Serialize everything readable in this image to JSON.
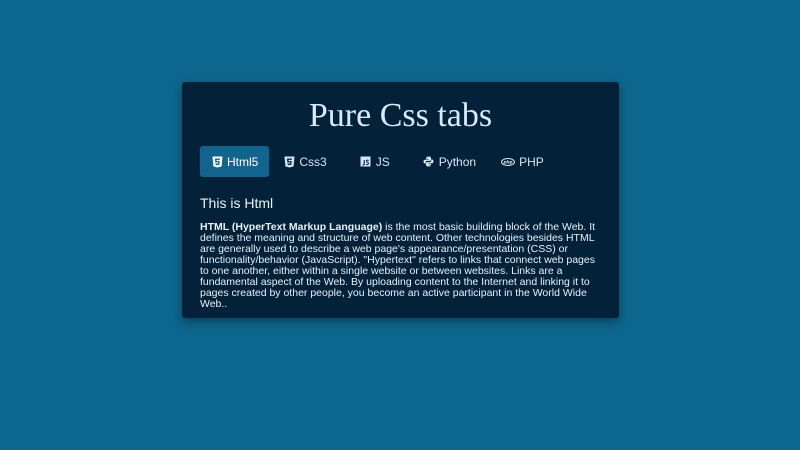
{
  "page": {
    "title": "Pure Css tabs"
  },
  "tabs": [
    {
      "label": "Html5",
      "icon": "html5-icon",
      "active": true
    },
    {
      "label": "Css3",
      "icon": "css3-icon",
      "active": false
    },
    {
      "label": "JS",
      "icon": "js-icon",
      "active": false
    },
    {
      "label": "Python",
      "icon": "python-icon",
      "active": false
    },
    {
      "label": "PHP",
      "icon": "php-icon",
      "active": false
    }
  ],
  "panel": {
    "heading": "This is Html",
    "bold_lead": "HTML (HyperText Markup Language)",
    "body": " is the most basic building block of the Web. It defines the meaning and structure of web content. Other technologies besides HTML are generally used to describe a web page's appearance/presentation (CSS) or functionality/behavior (JavaScript). \"Hypertext\" refers to links that connect web pages to one another, either within a single website or between websites. Links are a fundamental aspect of the Web. By uploading content to the Internet and linking it to pages created by other people, you become an active participant in the World Wide Web.."
  },
  "colors": {
    "background": "#0d668d",
    "card": "#03223a",
    "active_tab": "#10648e",
    "text": "#e8f1f7"
  }
}
